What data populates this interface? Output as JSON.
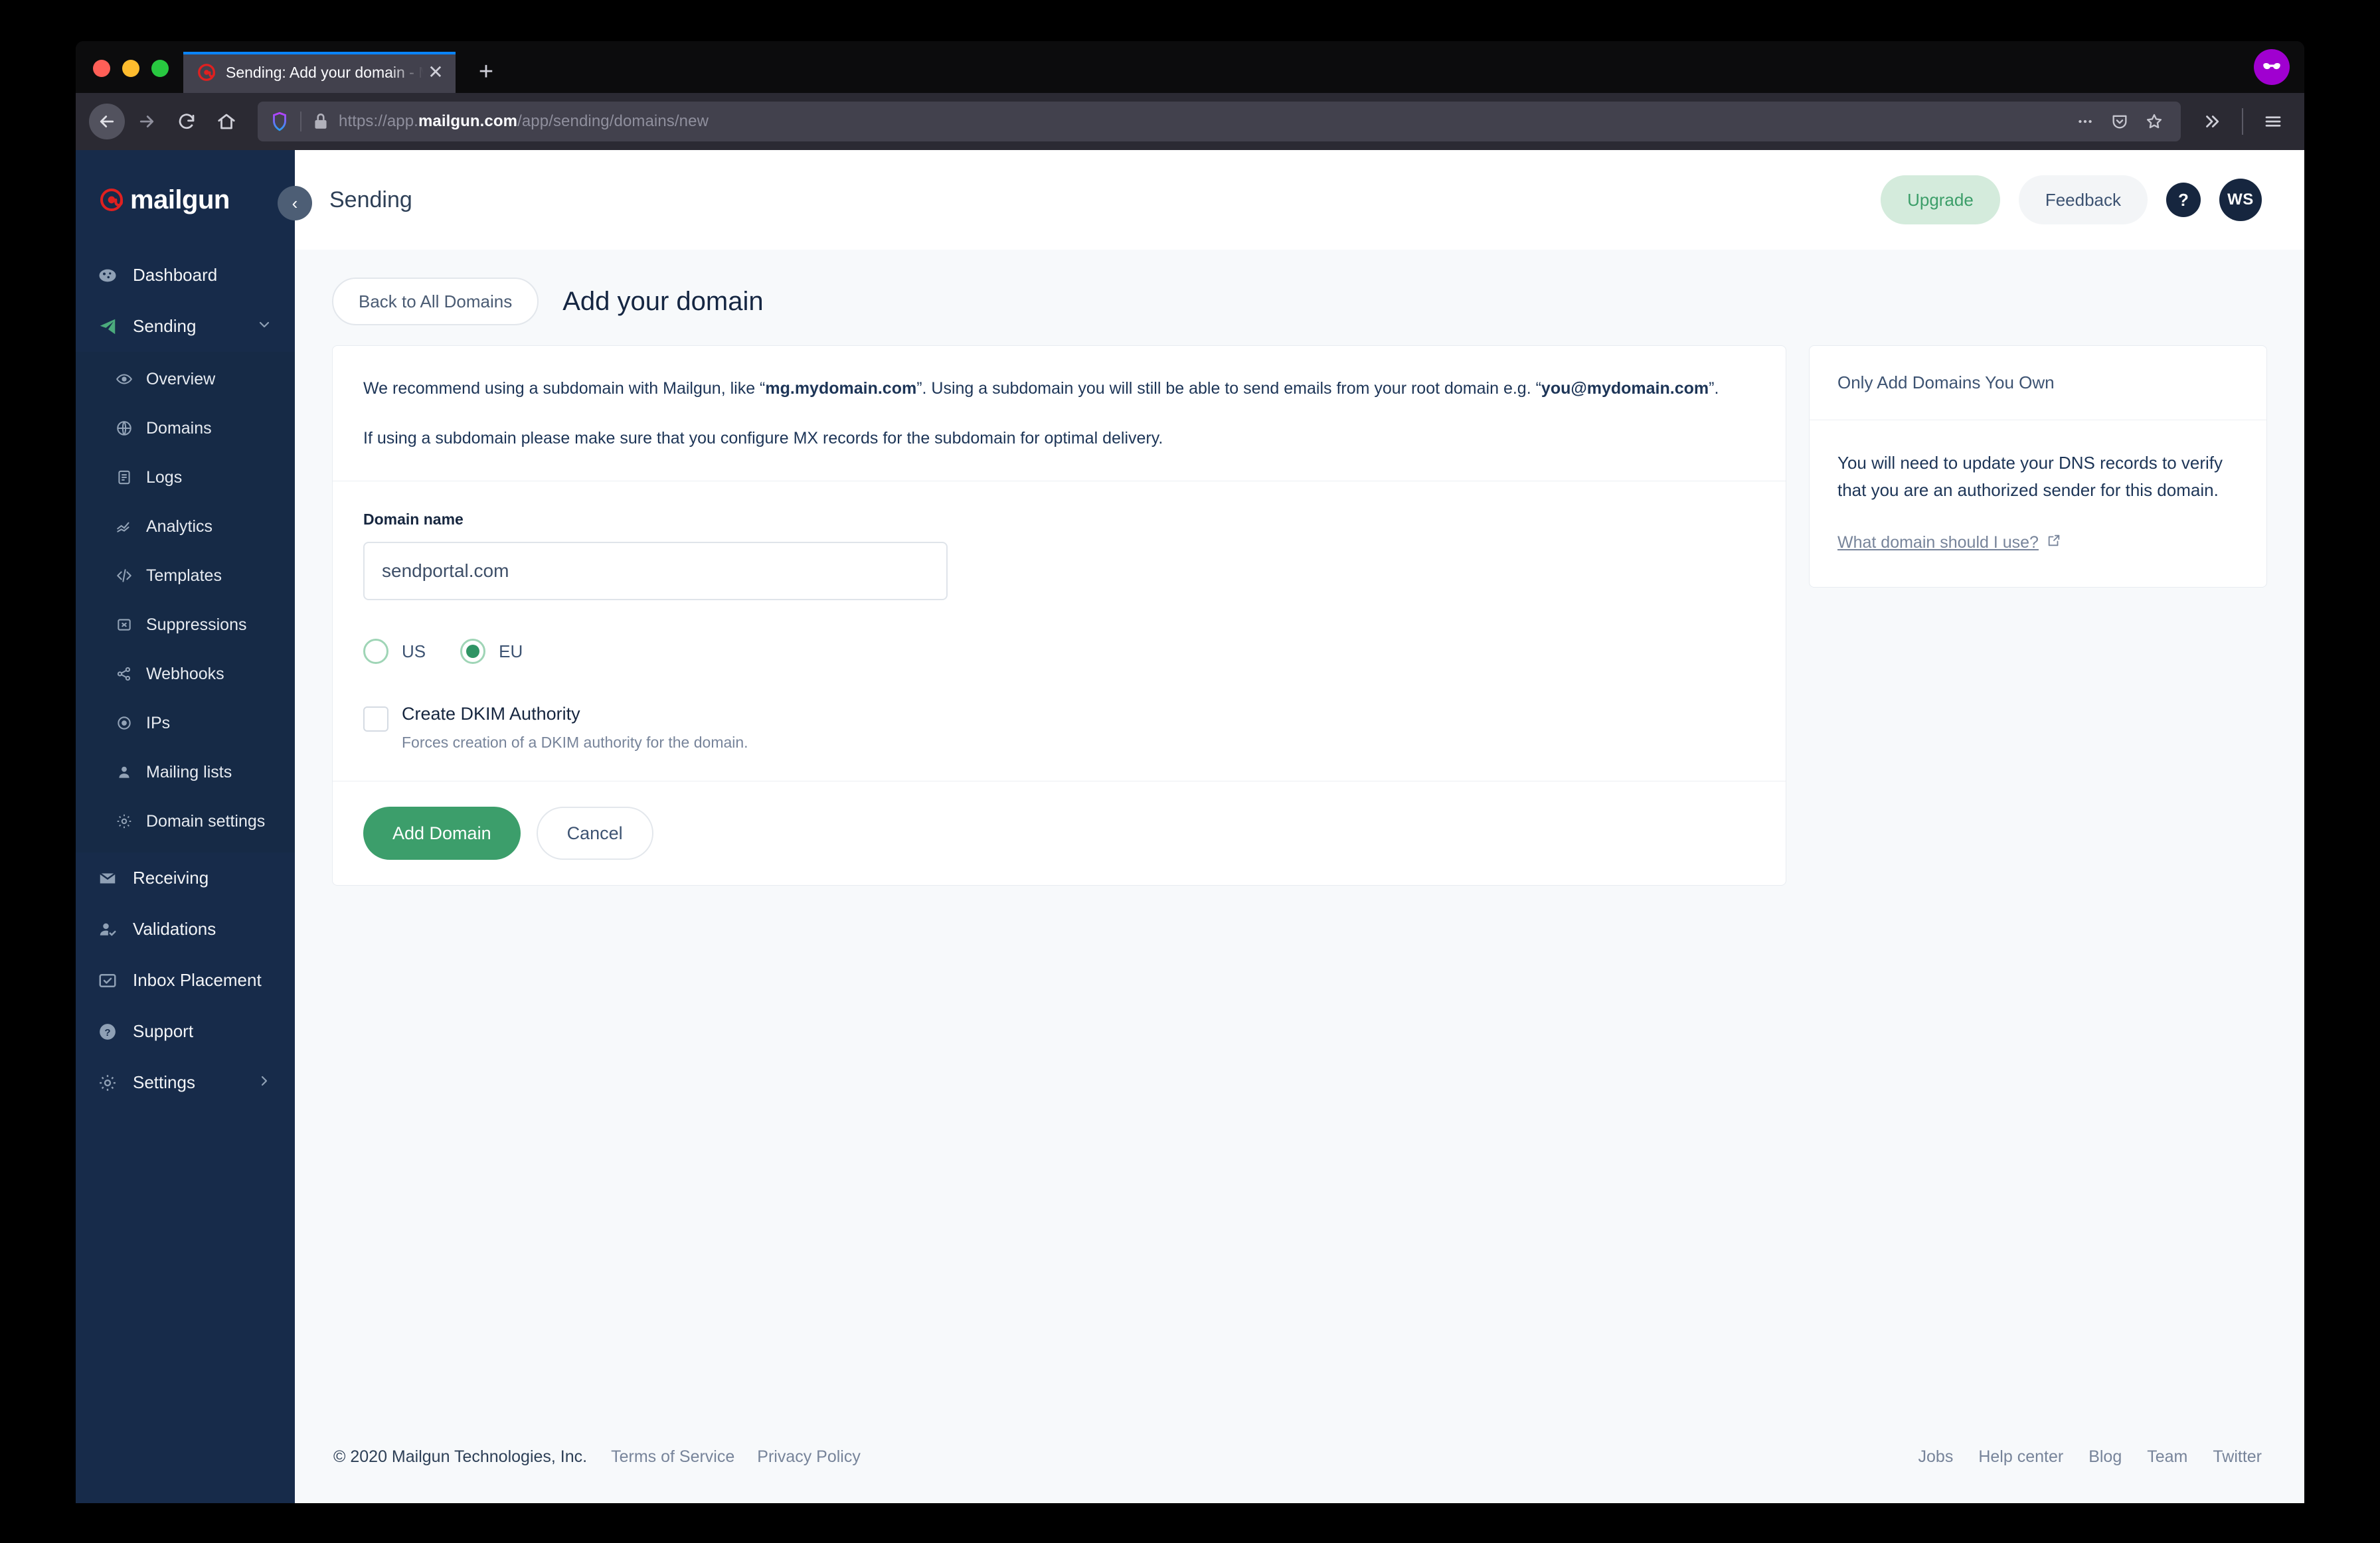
{
  "browser": {
    "tab": {
      "title": "Sending: Add your domain - Mai",
      "favicon_icon": "mailgun-at-icon",
      "close_icon": "close-icon"
    },
    "newtab_icon": "plus-icon",
    "private_badge_icon": "private-mask-icon",
    "nav": {
      "back_icon": "back-arrow-icon",
      "forward_icon": "forward-arrow-icon",
      "reload_icon": "reload-icon",
      "home_icon": "home-icon",
      "shield_icon": "shield-icon",
      "lock_icon": "lock-icon",
      "url_prefix": "https://app.",
      "url_bold": "mailgun.com",
      "url_suffix": "/app/sending/domains/new",
      "ellipsis_icon": "ellipsis-icon",
      "pocket_icon": "pocket-icon",
      "star_icon": "star-bookmark-icon",
      "overflow_icon": "chevron-double-right-icon",
      "menu_icon": "hamburger-menu-icon"
    }
  },
  "sidebar": {
    "logo_text": "mailgun",
    "collapse_icon": "chevron-left-icon",
    "items": [
      {
        "label": "Dashboard",
        "icon": "dashboard-icon"
      },
      {
        "label": "Sending",
        "icon": "paper-plane-icon",
        "chevron": "chevron-down-icon"
      }
    ],
    "subitems": [
      {
        "label": "Overview",
        "icon": "eye-icon"
      },
      {
        "label": "Domains",
        "icon": "globe-icon"
      },
      {
        "label": "Logs",
        "icon": "document-icon"
      },
      {
        "label": "Analytics",
        "icon": "analytics-chart-icon"
      },
      {
        "label": "Templates",
        "icon": "code-brackets-icon"
      },
      {
        "label": "Suppressions",
        "icon": "box-x-icon"
      },
      {
        "label": "Webhooks",
        "icon": "share-nodes-icon"
      },
      {
        "label": "IPs",
        "icon": "target-dot-icon"
      },
      {
        "label": "Mailing lists",
        "icon": "person-icon"
      },
      {
        "label": "Domain settings",
        "icon": "gear-icon"
      }
    ],
    "items_bottom": [
      {
        "label": "Receiving",
        "icon": "envelope-icon"
      },
      {
        "label": "Validations",
        "icon": "person-check-icon"
      },
      {
        "label": "Inbox Placement",
        "icon": "inbox-check-icon"
      },
      {
        "label": "Support",
        "icon": "question-circle-icon"
      },
      {
        "label": "Settings",
        "icon": "gear-icon",
        "chevron": "chevron-right-icon"
      }
    ]
  },
  "header": {
    "page_title": "Sending",
    "upgrade_label": "Upgrade",
    "feedback_label": "Feedback",
    "help_label": "?",
    "avatar_initials": "WS"
  },
  "subheader": {
    "back_label": "Back to All Domains",
    "title": "Add your domain"
  },
  "info": {
    "para1_a": "We recommend using a subdomain with Mailgun, like “",
    "para1_b": "mg.mydomain.com",
    "para1_c": "”. Using a subdomain you will still be able to send emails from your root domain e.g. “",
    "para1_d": "you@mydomain.com",
    "para1_e": "”.",
    "para2": "If using a subdomain please make sure that you configure MX records for the subdomain for optimal delivery."
  },
  "form": {
    "domain_label": "Domain name",
    "domain_value": "sendportal.com",
    "domain_placeholder": "",
    "region_options": [
      {
        "label": "US",
        "selected": false
      },
      {
        "label": "EU",
        "selected": true
      }
    ],
    "dkim_label": "Create DKIM Authority",
    "dkim_help": "Forces creation of a DKIM authority for the domain.",
    "dkim_checked": false,
    "submit_label": "Add Domain",
    "cancel_label": "Cancel"
  },
  "aside": {
    "heading": "Only Add Domains You Own",
    "body": "You will need to update your DNS records to verify that you are an authorized sender for this domain.",
    "link_label": "What domain should I use?",
    "link_icon": "external-link-icon"
  },
  "footer": {
    "copyright": "© 2020 Mailgun Technologies, Inc.",
    "left_links": [
      "Terms of Service",
      "Privacy Policy"
    ],
    "right_links": [
      "Jobs",
      "Help center",
      "Blog",
      "Team",
      "Twitter"
    ]
  },
  "colors": {
    "sidebar_bg": "#172b4a",
    "accent_green": "#3c9e6b",
    "page_bg": "#f7f9fb",
    "upgrade_bg": "#d4ebdc"
  }
}
